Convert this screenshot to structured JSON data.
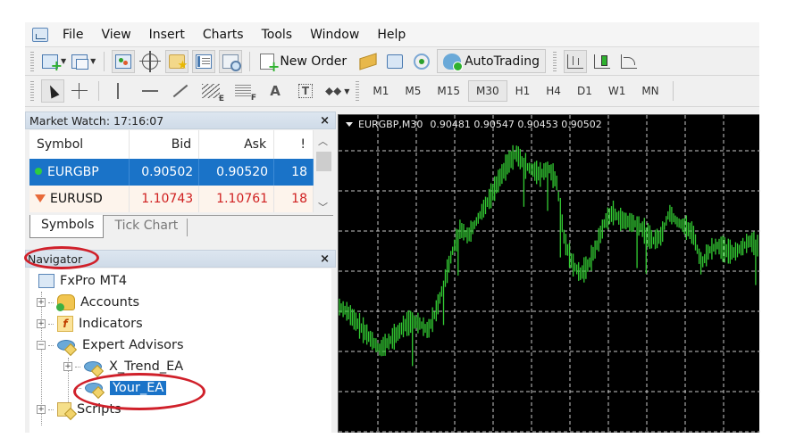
{
  "menu": {
    "items": [
      "File",
      "View",
      "Insert",
      "Charts",
      "Tools",
      "Window",
      "Help"
    ]
  },
  "toolbar": {
    "new_order_label": "New Order",
    "autotrading_label": "AutoTrading",
    "icons": [
      "new-chart",
      "profiles",
      "market-watch",
      "data-window",
      "navigator",
      "terminal",
      "strategy-tester",
      "new-order",
      "metaeditor",
      "community",
      "signals",
      "autotrading",
      "bar-chart",
      "candlesticks",
      "line-chart"
    ]
  },
  "drawing_toolbar": {
    "tools": [
      "cursor",
      "crosshair",
      "vertical-line",
      "horizontal-line",
      "trendline",
      "equidistant-channel",
      "fibonacci",
      "text",
      "text-label",
      "shapes"
    ],
    "text_tool_glyph": "A",
    "text_label_glyph": "T"
  },
  "timeframes": {
    "items": [
      "M1",
      "M5",
      "M15",
      "M30",
      "H1",
      "H4",
      "D1",
      "W1",
      "MN"
    ],
    "active": "M30"
  },
  "market_watch": {
    "title": "Market Watch: 17:16:07",
    "columns": [
      "Symbol",
      "Bid",
      "Ask",
      "!"
    ],
    "rows": [
      {
        "symbol": "EURGBP",
        "bid": "0.90502",
        "ask": "0.90520",
        "spread": "18",
        "direction": "up",
        "selected": true
      },
      {
        "symbol": "EURUSD",
        "bid": "1.10743",
        "ask": "1.10761",
        "spread": "18",
        "direction": "down",
        "selected": false
      }
    ],
    "tabs": [
      "Symbols",
      "Tick Chart"
    ],
    "active_tab": "Symbols",
    "close_glyph": "×"
  },
  "navigator": {
    "title": "Navigator",
    "close_glyph": "×",
    "tree": {
      "root": "FxPro MT4",
      "items": [
        {
          "label": "Accounts",
          "expander": "+"
        },
        {
          "label": "Indicators",
          "expander": "+"
        },
        {
          "label": "Expert Advisors",
          "expander": "−"
        },
        {
          "label": "X_Trend_EA",
          "expander": "+",
          "child": true
        },
        {
          "label": "Your_EA",
          "child": true,
          "selected": true
        },
        {
          "label": "Scripts",
          "expander": "+"
        }
      ]
    },
    "annotations": [
      "navigator-title-circled",
      "your-ea-circled"
    ]
  },
  "chart": {
    "header": "EURGBP,M30",
    "ohlc": "0.90481 0.90547 0.90453 0.90502",
    "colors": {
      "background": "#000000",
      "bars": "#33cc33",
      "grid": "#c8c8c8"
    }
  },
  "chart_data": {
    "type": "bar",
    "title": "EURGBP,M30",
    "symbol": "EURGBP",
    "timeframe": "M30",
    "last_bar": {
      "open": 0.90481,
      "high": 0.90547,
      "low": 0.90453,
      "close": 0.90502
    },
    "grid": true,
    "series_shape": [
      0.32,
      0.3,
      0.26,
      0.22,
      0.18,
      0.14,
      0.17,
      0.2,
      0.24,
      0.26,
      0.25,
      0.22,
      0.3,
      0.42,
      0.55,
      0.65,
      0.62,
      0.68,
      0.74,
      0.8,
      0.87,
      0.93,
      0.97,
      0.92,
      0.9,
      0.88,
      0.91,
      0.85,
      0.6,
      0.5,
      0.46,
      0.5,
      0.58,
      0.68,
      0.72,
      0.69,
      0.68,
      0.67,
      0.64,
      0.6,
      0.62,
      0.72,
      0.68,
      0.66,
      0.63,
      0.5,
      0.56,
      0.58,
      0.56,
      0.55,
      0.57,
      0.6,
      0.58
    ]
  }
}
